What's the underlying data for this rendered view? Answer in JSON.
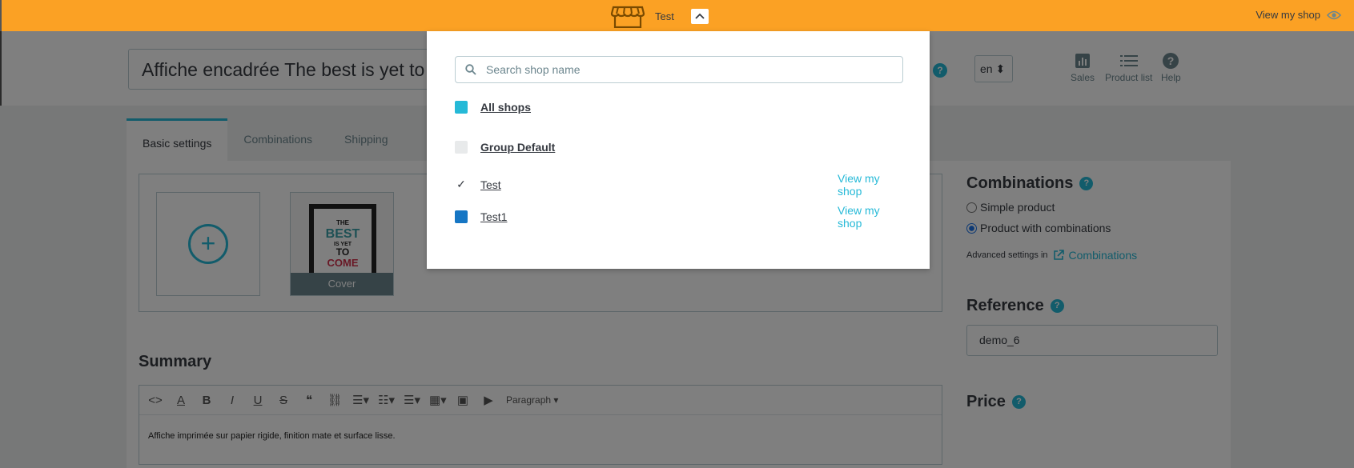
{
  "topbar": {
    "shop_name": "Test",
    "view_my_shop": "View my shop"
  },
  "header": {
    "product_title": "Affiche encadrée The best is yet to come",
    "lang": "en",
    "actions": [
      {
        "label": "Sales",
        "icon": "bar-chart-icon"
      },
      {
        "label": "Product list",
        "icon": "list-icon"
      },
      {
        "label": "Help",
        "icon": "help-icon"
      }
    ]
  },
  "tabs": [
    "Basic settings",
    "Combinations",
    "Shipping"
  ],
  "images": {
    "cover_label": "Cover"
  },
  "summary": {
    "title": "Summary",
    "paragraph_label": "Paragraph",
    "body": "Affiche imprimée sur papier rigide, finition mate et surface lisse."
  },
  "side": {
    "combinations_title": "Combinations",
    "simple_product": "Simple product",
    "product_with_combinations": "Product with combinations",
    "advanced_settings": "Advanced settings in",
    "combinations_link": "Combinations",
    "reference_title": "Reference",
    "reference_value": "demo_6",
    "price_title": "Price"
  },
  "dropdown": {
    "search_placeholder": "Search shop name",
    "rows": [
      {
        "label": "All shops",
        "color": "#25b9d7",
        "bold": true
      },
      {
        "label": "Group Default",
        "color": "#e8eaeb",
        "bold": true
      },
      {
        "label": "Test",
        "checked": true,
        "view": "View my shop"
      },
      {
        "label": "Test1",
        "color": "#1676c4",
        "view": "View my shop"
      }
    ]
  },
  "colors": {
    "accent": "#25b9d7",
    "topbar": "#fba124"
  }
}
